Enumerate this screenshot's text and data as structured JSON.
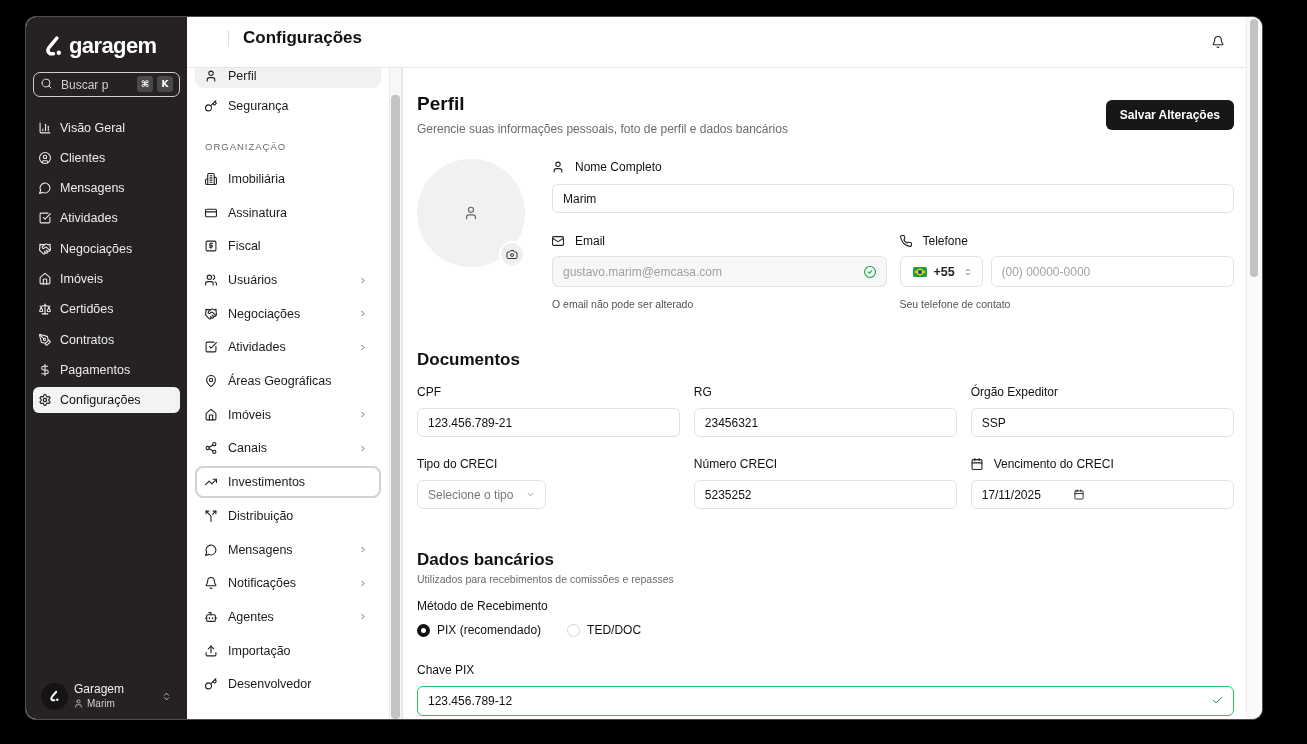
{
  "app_sidebar": {
    "logo": "garagem",
    "search": {
      "placeholder": "Buscar p",
      "shortcut_keys": [
        "⌘",
        "K"
      ]
    },
    "items": [
      {
        "label": "Visão Geral",
        "selected": false
      },
      {
        "label": "Clientes",
        "selected": false
      },
      {
        "label": "Mensagens",
        "selected": false
      },
      {
        "label": "Atividades",
        "selected": false
      },
      {
        "label": "Negociações",
        "selected": false
      },
      {
        "label": "Imóveis",
        "selected": false
      },
      {
        "label": "Certidões",
        "selected": false
      },
      {
        "label": "Contratos",
        "selected": false
      },
      {
        "label": "Pagamentos",
        "selected": false
      },
      {
        "label": "Configurações",
        "selected": true
      }
    ],
    "workspace": {
      "name": "Garagem",
      "user": "Marim"
    }
  },
  "header": {
    "title": "Configurações"
  },
  "settings_nav": {
    "items": [
      {
        "kind": "item",
        "label": "Perfil",
        "selected": true,
        "focused": false,
        "expandable": false
      },
      {
        "kind": "item",
        "label": "Segurança",
        "selected": false,
        "focused": false,
        "expandable": false
      },
      {
        "kind": "section",
        "label": "ORGANIZAÇÃO"
      },
      {
        "kind": "item",
        "label": "Imobiliária",
        "selected": false,
        "focused": false,
        "expandable": false
      },
      {
        "kind": "item",
        "label": "Assinatura",
        "selected": false,
        "focused": false,
        "expandable": false
      },
      {
        "kind": "item",
        "label": "Fiscal",
        "selected": false,
        "focused": false,
        "expandable": false
      },
      {
        "kind": "item",
        "label": "Usuários",
        "selected": false,
        "focused": false,
        "expandable": true
      },
      {
        "kind": "item",
        "label": "Negociações",
        "selected": false,
        "focused": false,
        "expandable": true
      },
      {
        "kind": "item",
        "label": "Atividades",
        "selected": false,
        "focused": false,
        "expandable": true
      },
      {
        "kind": "item",
        "label": "Áreas Geográficas",
        "selected": false,
        "focused": false,
        "expandable": false
      },
      {
        "kind": "item",
        "label": "Imóveis",
        "selected": false,
        "focused": false,
        "expandable": true
      },
      {
        "kind": "item",
        "label": "Canais",
        "selected": false,
        "focused": false,
        "expandable": true
      },
      {
        "kind": "item",
        "label": "Investimentos",
        "selected": false,
        "focused": true,
        "expandable": false
      },
      {
        "kind": "item",
        "label": "Distribuição",
        "selected": false,
        "focused": false,
        "expandable": false
      },
      {
        "kind": "item",
        "label": "Mensagens",
        "selected": false,
        "focused": false,
        "expandable": true
      },
      {
        "kind": "item",
        "label": "Notificações",
        "selected": false,
        "focused": false,
        "expandable": true
      },
      {
        "kind": "item",
        "label": "Agentes",
        "selected": false,
        "focused": false,
        "expandable": true
      },
      {
        "kind": "item",
        "label": "Importação",
        "selected": false,
        "focused": false,
        "expandable": false
      },
      {
        "kind": "item",
        "label": "Desenvolvedor",
        "selected": false,
        "focused": false,
        "expandable": false
      }
    ]
  },
  "profile": {
    "title": "Perfil",
    "subtitle": "Gerencie suas informações pessoais, foto de perfil e dados bancários",
    "save_button": "Salvar Alterações",
    "full_name": {
      "label": "Nome Completo",
      "value": "Marim"
    },
    "email": {
      "label": "Email",
      "value": "gustavo.marim@emcasa.com",
      "disabled": true,
      "verified": true,
      "hint": "O email não pode ser alterado"
    },
    "phone": {
      "label": "Telefone",
      "country_code": "+55",
      "placeholder": "(00) 00000-0000",
      "hint": "Seu telefone de contato"
    }
  },
  "documents": {
    "title": "Documentos",
    "fields": [
      {
        "kind": "text",
        "label": "CPF",
        "value": "123.456.789-21"
      },
      {
        "kind": "text",
        "label": "RG",
        "value": "23456321"
      },
      {
        "kind": "text",
        "label": "Órgão Expeditor",
        "value": "SSP"
      },
      {
        "kind": "select",
        "label": "Tipo do CRECI",
        "placeholder": "Selecione o tipo"
      },
      {
        "kind": "text",
        "label": "Número CRECI",
        "value": "5235252"
      },
      {
        "kind": "date",
        "label": "Vencimento do CRECI",
        "value": "17/11/2025"
      }
    ]
  },
  "banking": {
    "title": "Dados bancários",
    "subtitle": "Utilizados para recebimentos de comissões e repasses",
    "method": {
      "label": "Método de Recebimento",
      "options": [
        {
          "label": "PIX (recomendado)",
          "selected": true
        },
        {
          "label": "TED/DOC",
          "selected": false
        }
      ]
    },
    "pix_key": {
      "label": "Chave PIX",
      "value": "123.456.789-12",
      "valid": true
    }
  }
}
